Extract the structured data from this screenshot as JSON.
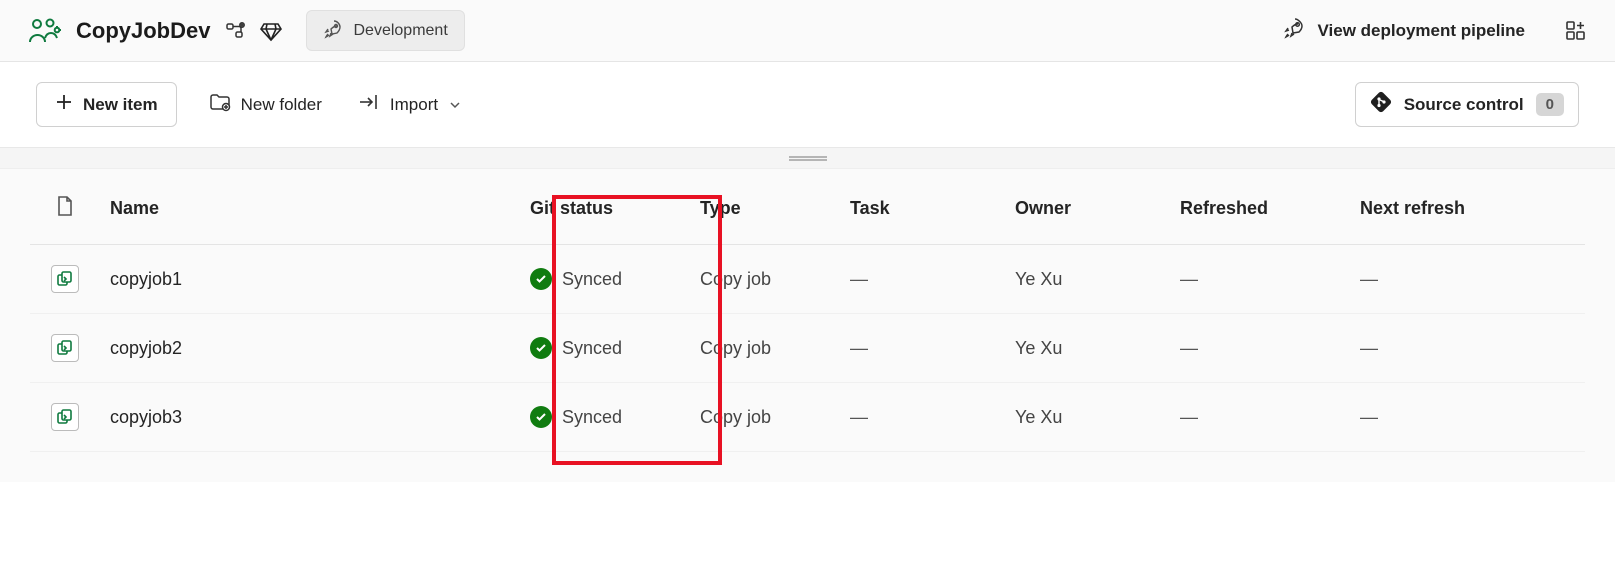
{
  "header": {
    "workspace_name": "CopyJobDev",
    "stage_label": "Development",
    "deployment_link": "View deployment pipeline"
  },
  "toolbar": {
    "new_item_label": "New item",
    "new_folder_label": "New folder",
    "import_label": "Import",
    "source_control_label": "Source control",
    "source_control_badge": "0"
  },
  "columns": {
    "name": "Name",
    "git_status": "Git status",
    "type": "Type",
    "task": "Task",
    "owner": "Owner",
    "refreshed": "Refreshed",
    "next_refresh": "Next refresh"
  },
  "rows": [
    {
      "name": "copyjob1",
      "git_status": "Synced",
      "type": "Copy job",
      "task": "—",
      "owner": "Ye Xu",
      "refreshed": "—",
      "next_refresh": "—"
    },
    {
      "name": "copyjob2",
      "git_status": "Synced",
      "type": "Copy job",
      "task": "—",
      "owner": "Ye Xu",
      "refreshed": "—",
      "next_refresh": "—"
    },
    {
      "name": "copyjob3",
      "git_status": "Synced",
      "type": "Copy job",
      "task": "—",
      "owner": "Ye Xu",
      "refreshed": "—",
      "next_refresh": "—"
    }
  ]
}
